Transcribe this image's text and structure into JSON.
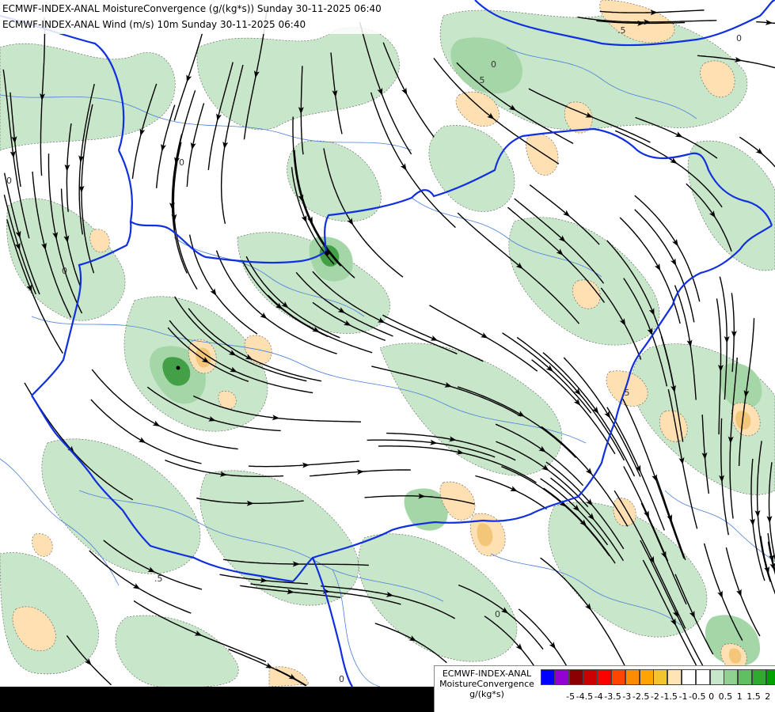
{
  "titles": {
    "line1": "ECMWF-INDEX-ANAL MoistureConvergence (g/(kg*s)) Sunday 30-11-2025 06:40",
    "line2": "ECMWF-INDEX-ANAL Wind (m/s) 10m Sunday 30-11-2025 06:40"
  },
  "legend": {
    "title_lines": [
      "ECMWF-INDEX-ANAL",
      "MoistureConvergence",
      "g/(kg*s)"
    ],
    "colors": [
      "#0000ff",
      "#9400d3",
      "#8b0000",
      "#cc0000",
      "#ff0000",
      "#ff4500",
      "#ff8c00",
      "#ffa500",
      "#f4c430",
      "#ffe4b5",
      "#ffffff",
      "#ffffff",
      "#c8e6c9",
      "#90d090",
      "#60c060",
      "#2eaa2e",
      "#00a000"
    ],
    "labels": [
      "-5",
      "-4.5",
      "-4",
      "-3.5",
      "-3",
      "-2.5",
      "-2",
      "-1.5",
      "-1",
      "-0.5",
      "0",
      "0.5",
      "1",
      "1.5",
      "2"
    ]
  },
  "map": {
    "contour_labels": [
      "0",
      "0",
      "0",
      "0",
      "0",
      ".5",
      ".5",
      ".5",
      ".5",
      "0",
      "0"
    ],
    "colors": {
      "background": "#ffffff",
      "convergence_light": "#c8e6c9",
      "convergence_mid": "#a5d6a7",
      "convergence_strong": "#43a047",
      "divergence_light": "#ffe0b2",
      "divergence_mid": "#f4c67a",
      "border": "#1030e0",
      "river": "#4a7fd9",
      "streamline": "#000000"
    }
  }
}
